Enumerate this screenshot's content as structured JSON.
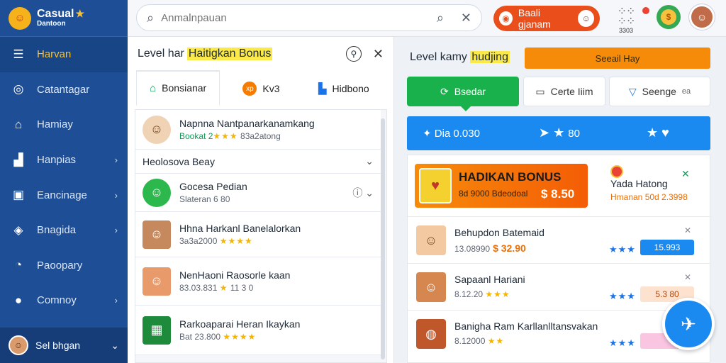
{
  "brand": {
    "title": "Casual",
    "subtitle": "Dantoon",
    "logo_icon": "mascot-logo-icon"
  },
  "sidebar": {
    "items": [
      {
        "label": "Harvan",
        "icon": "list-icon",
        "active": true,
        "chevron": false
      },
      {
        "label": "Catantagar",
        "icon": "target-icon",
        "chevron": false
      },
      {
        "label": "Hamiay",
        "icon": "home-icon",
        "chevron": false
      },
      {
        "label": "Hanpias",
        "icon": "chart-icon",
        "chevron": true
      },
      {
        "label": "Eancinage",
        "icon": "bag-icon",
        "chevron": true
      },
      {
        "label": "Bnagida",
        "icon": "tag-icon",
        "chevron": true
      },
      {
        "label": "Paoopary",
        "icon": "pie-icon",
        "chevron": false
      },
      {
        "label": "Comnoy",
        "icon": "globe-icon",
        "chevron": true
      }
    ],
    "user": {
      "label": "Sel bhgan"
    }
  },
  "topbar": {
    "search_placeholder": "Anmalnpauan",
    "promo_label": "Baali gjanam",
    "apps_label": "3303"
  },
  "middle": {
    "title_prefix": "Level har",
    "title_highlight": "Haitigkan Bonus",
    "tabs": [
      {
        "label": "Bonsianar",
        "icon": "home-icon"
      },
      {
        "label": "Kv3",
        "icon": "xp-icon"
      },
      {
        "label": "Hidbono",
        "icon": "boot-icon"
      }
    ],
    "rows": [
      {
        "name": "Napnna Nantpanarkanamkang",
        "meta_prefix": "Bookat",
        "meta_rating": "2",
        "meta_stars": "★★★",
        "meta_suffix": "83a2atong",
        "icon": "avatar-icon"
      },
      {
        "name": "Heolosova Beay",
        "section": true
      },
      {
        "name": "Gocesa Pedian",
        "meta_prefix": "Slateran",
        "meta_suffix": "6 80",
        "icon": "coin-icon"
      },
      {
        "name": "Hhna Harkanl Banelalorkan",
        "meta_prefix": "3a3a2000",
        "meta_stars": "★★★★",
        "icon": "boy-icon"
      },
      {
        "name": "NenHaoni Raosorle kaan",
        "meta_prefix": "83.03.831",
        "meta_stars": "★",
        "meta_suffix": "11 3 0",
        "icon": "girl-icon"
      },
      {
        "name": "Rarkoaparai Heran Ikaykan",
        "meta_prefix": "Bat 23.800",
        "meta_stars": "★★★★",
        "icon": "box-icon"
      }
    ]
  },
  "right": {
    "title_prefix": "Level kamy",
    "title_highlight": "hudjing",
    "special_label": "Seeail Hay",
    "buttons": {
      "green": "Bsedar",
      "cert": "Certe Iiim",
      "sem": "Seenge"
    },
    "blue_bar": {
      "text": "Dia 0.030",
      "val2": "80"
    },
    "bonus": {
      "title": "HADIKAN BONUS",
      "subtitle": "8d 9000 Bdeodoal",
      "value": "$ 8.50",
      "side_title": "Yada Hatong",
      "side_price": "Hmanan 50d 2.3998"
    },
    "products": [
      {
        "name": "Behupdon Batemaid",
        "meta": "13.08990",
        "price": "$ 32.90",
        "stars": "★★★",
        "badge": "15.993",
        "badge_bg": "#1b8af0",
        "badge_fg": "#fff",
        "icon": "kid-icon"
      },
      {
        "name": "Sapaanl Hariani",
        "meta": "8.12.20",
        "price": "",
        "mini_stars": "★★★",
        "stars": "★★★",
        "badge": "5.3 80",
        "badge_bg": "#fde3cf",
        "badge_fg": "#b54708",
        "icon": "girl-icon"
      },
      {
        "name": "Banigha Ram Karllanlltansvakan",
        "meta": "8.12000",
        "price": "",
        "mini_stars": "★★",
        "stars": "★★★",
        "badge": "",
        "badge_bg": "#f9c5e0",
        "badge_fg": "#a0195d",
        "icon": "food-icon"
      }
    ]
  },
  "colors": {
    "sidebar": "#1e4e96",
    "accent_orange": "#f68b0a",
    "accent_blue": "#1b8af0",
    "accent_green": "#18b14b"
  }
}
